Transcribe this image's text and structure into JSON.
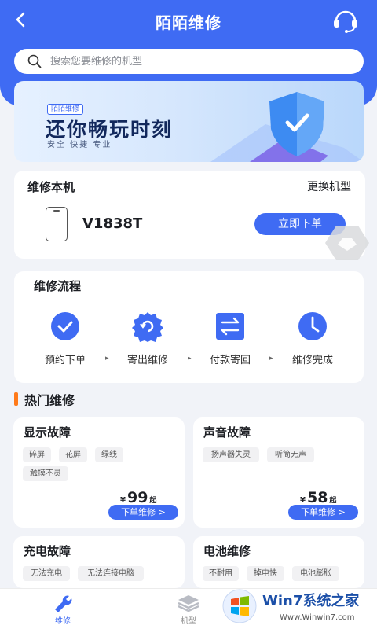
{
  "header": {
    "back_icon": "chevron-left-icon",
    "title": "陌陌维修",
    "service_icon": "headset-icon"
  },
  "search": {
    "placeholder": "搜索您要维修的机型",
    "icon": "search-icon"
  },
  "banner": {
    "tag": "陌陌维修",
    "slogan": "还你畅玩时刻",
    "sub": "安全 快捷 专业",
    "icon": "shield-check-icon"
  },
  "device": {
    "title": "维修本机",
    "change_label": "更换机型",
    "model": "V1838T",
    "order_label": "立即下单",
    "icon": "phone-icon"
  },
  "process": {
    "title": "维修流程",
    "steps": [
      {
        "label": "预约下单",
        "icon": "check-circle-icon"
      },
      {
        "label": "寄出维修",
        "icon": "gear-refresh-icon"
      },
      {
        "label": "付款寄回",
        "icon": "exchange-icon"
      },
      {
        "label": "维修完成",
        "icon": "clock-icon"
      }
    ],
    "arrow": "▸"
  },
  "hot": {
    "title": "热门维修",
    "cards": [
      {
        "title": "显示故障",
        "tags": [
          "碎屏",
          "花屏",
          "绿线",
          "触摸不灵"
        ],
        "yen": "¥",
        "price": "99",
        "suffix": "起",
        "button": "下单维修 >"
      },
      {
        "title": "声音故障",
        "tags": [
          "扬声器失灵",
          "听筒无声"
        ],
        "yen": "¥",
        "price": "58",
        "suffix": "起",
        "button": "下单维修 >"
      },
      {
        "title": "充电故障",
        "tags": [
          "无法充电",
          "无法连接电脑"
        ]
      },
      {
        "title": "电池维修",
        "tags": [
          "不耐用",
          "掉电快",
          "电池膨胀"
        ]
      }
    ]
  },
  "tabbar": {
    "tabs": [
      {
        "label": "维修",
        "icon": "wrench-icon"
      },
      {
        "label": "机型",
        "icon": "layers-icon"
      }
    ]
  },
  "watermark": {
    "title": "Win7系统之家",
    "url": "Www.Winwin7.com"
  },
  "colors": {
    "accent": "#3f6bf3",
    "hot_bar": "#ff7a1a",
    "background": "#f1f3f8"
  }
}
